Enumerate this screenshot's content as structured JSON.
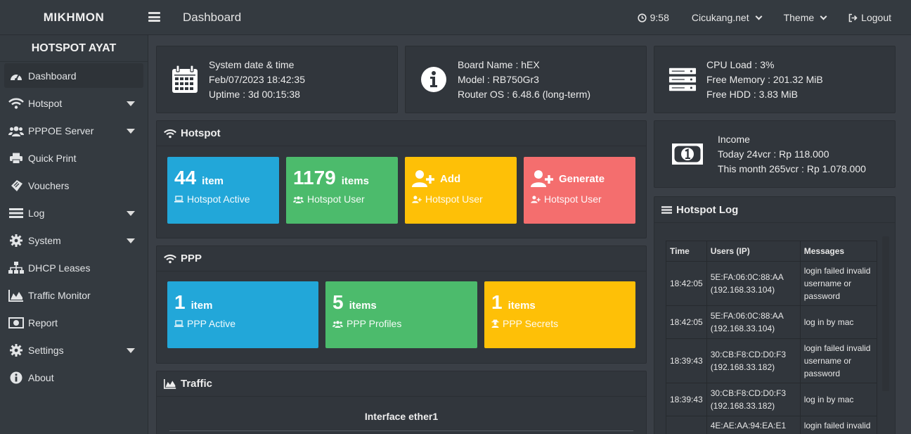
{
  "header": {
    "brand": "MIKHMON",
    "page_title": "Dashboard",
    "clock": "9:58",
    "domain": "Cicukang.net",
    "theme_label": "Theme",
    "logout_label": "Logout"
  },
  "sidebar": {
    "session_name": "HOTSPOT AYAT",
    "items": [
      {
        "label": "Dashboard",
        "icon": "dashboard-icon"
      },
      {
        "label": "Hotspot",
        "icon": "wifi-icon"
      },
      {
        "label": "PPPOE Server",
        "icon": "users-icon"
      },
      {
        "label": "Quick Print",
        "icon": "printer-icon"
      },
      {
        "label": "Vouchers",
        "icon": "ticket-icon"
      },
      {
        "label": "Log",
        "icon": "list-icon"
      },
      {
        "label": "System",
        "icon": "gear-icon"
      },
      {
        "label": "DHCP Leases",
        "icon": "sitemap-icon"
      },
      {
        "label": "Traffic Monitor",
        "icon": "area-chart-icon"
      },
      {
        "label": "Report",
        "icon": "money-icon"
      },
      {
        "label": "Settings",
        "icon": "gear-icon"
      },
      {
        "label": "About",
        "icon": "info-icon"
      }
    ]
  },
  "system_box": {
    "line1": "System date & time",
    "line2": "Feb/07/2023 18:42:35",
    "line3": "Uptime : 3d 00:15:38"
  },
  "board_box": {
    "line1": "Board Name : hEX",
    "line2": "Model : RB750Gr3",
    "line3": "Router OS : 6.48.6 (long-term)"
  },
  "resource_box": {
    "line1": "CPU Load : 3%",
    "line2": "Free Memory : 201.32 MiB",
    "line3": "Free HDD : 3.83 MiB"
  },
  "income_box": {
    "line1": "Income",
    "line2": "Today 24vcr : Rp 118.000",
    "line3": "This month 265vcr : Rp 1.078.000"
  },
  "hotspot": {
    "title": "Hotspot",
    "tiles": [
      {
        "num": "44",
        "unit": "item",
        "label": "Hotspot Active"
      },
      {
        "num": "1179",
        "unit": "items",
        "label": "Hotspot User"
      },
      {
        "num": "",
        "unit": "Add",
        "label": "Hotspot User"
      },
      {
        "num": "",
        "unit": "Generate",
        "label": "Hotspot User"
      }
    ]
  },
  "ppp": {
    "title": "PPP",
    "tiles": [
      {
        "num": "1",
        "unit": "item",
        "label": "PPP Active"
      },
      {
        "num": "5",
        "unit": "items",
        "label": "PPP Profiles"
      },
      {
        "num": "1",
        "unit": "items",
        "label": "PPP Secrets"
      }
    ]
  },
  "traffic": {
    "title": "Traffic",
    "interface": "Interface ether1"
  },
  "hotspot_log": {
    "title": "Hotspot Log",
    "columns": [
      "Time",
      "Users (IP)",
      "Messages"
    ],
    "rows": [
      {
        "time": "18:42:05",
        "mac": "5E:FA:06:0C:88:AA",
        "ip": "(192.168.33.104)",
        "msg": "login failed invalid username or password"
      },
      {
        "time": "18:42:05",
        "mac": "5E:FA:06:0C:88:AA",
        "ip": "(192.168.33.104)",
        "msg": "log in by mac"
      },
      {
        "time": "18:39:43",
        "mac": "30:CB:F8:CD:D0:F3",
        "ip": "(192.168.33.182)",
        "msg": "login failed invalid username or password"
      },
      {
        "time": "18:39:43",
        "mac": "30:CB:F8:CD:D0:F3",
        "ip": "(192.168.33.182)",
        "msg": "log in by mac"
      },
      {
        "time": "",
        "mac": "4E:AE:AA:94:EA:E1",
        "ip": "",
        "msg": "login failed invalid"
      }
    ]
  },
  "colors": {
    "blue": "#22a7d9",
    "green": "#4cbb6c",
    "yellow": "#fec007",
    "red": "#f46e6e",
    "background": "#3a3f46",
    "panel": "#31363c"
  }
}
